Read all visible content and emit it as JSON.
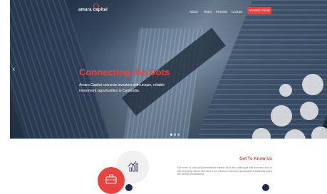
{
  "brand": {
    "logo_text": "amara capital",
    "accent": "#e8433f",
    "navy": "#1d2d45"
  },
  "nav": {
    "items": [
      "About",
      "Team",
      "Process",
      "Contact"
    ],
    "cta_label": "Investor Portal"
  },
  "hero": {
    "headline": "Connecting the Dots",
    "subtitle": "Amara Capital connects investors with unique, reliable investment opportunities in Cambodia.",
    "slide_count": 3,
    "active_slide": 1
  },
  "about": {
    "title": "Get To Know Us",
    "text": "Our team of local and international experts know the challenges that investors face in this emerging market and have it our mission to discover and support businesses which are worthy of investment."
  },
  "icons": {
    "prev_arrow": "chevron-left-icon",
    "logo_mark": "circle-logo-icon",
    "growth": "bar-chart-growth-icon",
    "briefcase": "briefcase-icon"
  }
}
